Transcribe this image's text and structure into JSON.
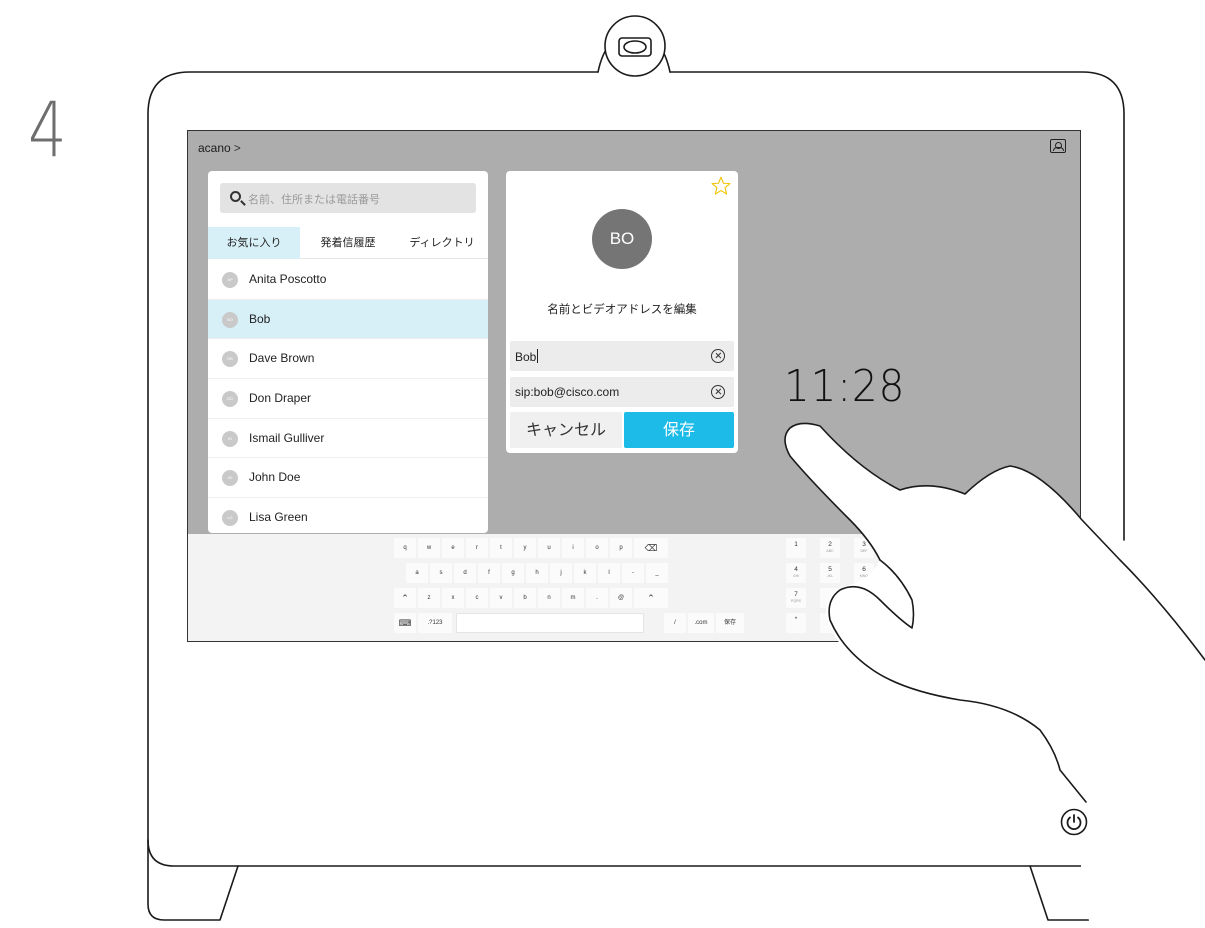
{
  "step_number": "4",
  "screen": {
    "breadcrumb": {
      "label": "acano",
      "chevron": ">"
    }
  },
  "search": {
    "placeholder": "名前、住所または電話番号"
  },
  "tabs": [
    {
      "label": "お気に入り",
      "active": true
    },
    {
      "label": "発着信履歴",
      "active": false
    },
    {
      "label": "ディレクトリ",
      "active": false
    }
  ],
  "contacts": [
    {
      "initials": "AP",
      "name": "Anita Poscotto",
      "selected": false
    },
    {
      "initials": "BO",
      "name": "Bob",
      "selected": true
    },
    {
      "initials": "DB",
      "name": "Dave Brown",
      "selected": false
    },
    {
      "initials": "DD",
      "name": "Don Draper",
      "selected": false
    },
    {
      "initials": "IG",
      "name": "Ismail Gulliver",
      "selected": false
    },
    {
      "initials": "JD",
      "name": "John Doe",
      "selected": false
    },
    {
      "initials": "LG",
      "name": "Lisa Green",
      "selected": false
    }
  ],
  "edit_panel": {
    "favorite_icon": "star-outline-icon",
    "avatar_initials": "BO",
    "title": "名前とビデオアドレスを編集",
    "name_value": "Bob",
    "address_value": "sip:bob@cisco.com",
    "cancel_label": "キャンセル",
    "save_label": "保存"
  },
  "clock": "11:28",
  "keyboard": {
    "rows": [
      [
        "q",
        "w",
        "e",
        "r",
        "t",
        "y",
        "u",
        "i",
        "o",
        "p",
        "⌫"
      ],
      [
        "a",
        "s",
        "d",
        "f",
        "g",
        "h",
        "j",
        "k",
        "l",
        "-",
        "_"
      ],
      [
        "⌃",
        "z",
        "x",
        "c",
        "v",
        "b",
        "n",
        "m",
        ".",
        "@",
        "⌃"
      ],
      [
        "⌨",
        ".?123",
        "",
        "/",
        ".com",
        "保存"
      ]
    ],
    "numpad": [
      {
        "digit": "1",
        "letters": ""
      },
      {
        "digit": "2",
        "letters": "ABC"
      },
      {
        "digit": "3",
        "letters": "DEF"
      },
      {
        "digit": "4",
        "letters": "GHI"
      },
      {
        "digit": "5",
        "letters": "JKL"
      },
      {
        "digit": "6",
        "letters": "MNO"
      },
      {
        "digit": "7",
        "letters": "PQRS"
      },
      {
        "digit": "",
        "letters": ""
      },
      {
        "digit": "",
        "letters": ""
      },
      {
        "digit": "*",
        "letters": ""
      },
      {
        "digit": "0",
        "letters": "+"
      },
      {
        "digit": "",
        "letters": ""
      }
    ]
  },
  "colors": {
    "accent": "#1cbbe8",
    "selected_row": "#d7f0f7",
    "screen_background": "#adadad"
  },
  "icons": {
    "camera": "camera-icon",
    "self_view": "self-view-icon",
    "power": "power-icon",
    "hand": "hand-pointer-illustration"
  }
}
